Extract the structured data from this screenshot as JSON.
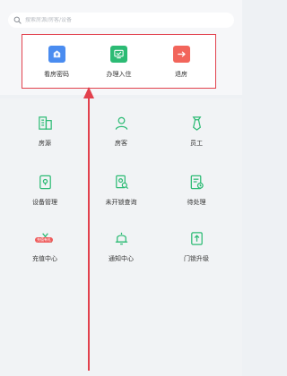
{
  "search": {
    "placeholder": "搜索房源/房客/设备"
  },
  "quick_actions": [
    {
      "label": "看房密码",
      "icon": "key-icon",
      "color": "#4a8cf0"
    },
    {
      "label": "办理入住",
      "icon": "checkin-monitor-icon",
      "color": "#2cbb74"
    },
    {
      "label": "退房",
      "icon": "checkout-arrow-icon",
      "color": "#f2655b"
    }
  ],
  "grid": [
    {
      "label": "房源",
      "icon": "building-icon"
    },
    {
      "label": "房客",
      "icon": "guest-person-icon"
    },
    {
      "label": "员工",
      "icon": "staff-tie-icon"
    },
    {
      "label": "设备管理",
      "icon": "device-lock-icon"
    },
    {
      "label": "未开锁查询",
      "icon": "unopened-lock-query-icon"
    },
    {
      "label": "待处理",
      "icon": "pending-tasks-icon"
    },
    {
      "label": "充值中心",
      "icon": "recharge-coin-icon",
      "badge": "充值有礼"
    },
    {
      "label": "通知中心",
      "icon": "notification-bell-icon"
    },
    {
      "label": "门锁升级",
      "icon": "lock-upgrade-icon"
    }
  ],
  "colors": {
    "icon_green": "#2cbb74",
    "highlight_red": "#e2414d"
  }
}
